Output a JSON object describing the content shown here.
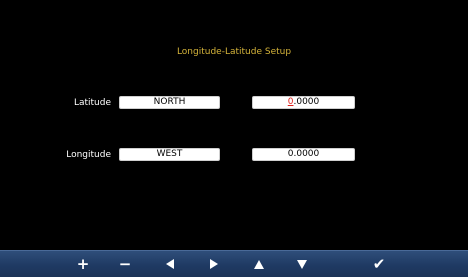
{
  "title": "Longitude-Latitude Setup",
  "latitude": {
    "label": "Latitude",
    "direction": "NORTH",
    "value_cursor_digit": "0",
    "value_rest": ".0000"
  },
  "longitude": {
    "label": "Longitude",
    "direction": "WEST",
    "value": "0.0000"
  },
  "toolbar": {
    "plus": "+",
    "minus": "−",
    "confirm": "✔"
  },
  "colors": {
    "background": "#000000",
    "title": "#d4b33a",
    "cursor_digit": "#e0201c",
    "toolbar": "#1f3a63"
  }
}
